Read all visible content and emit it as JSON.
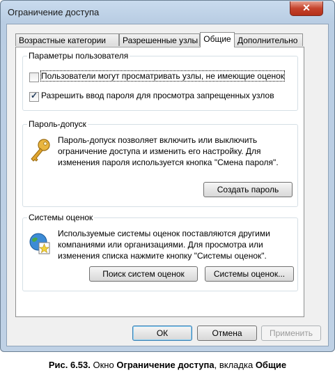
{
  "window": {
    "title": "Ограничение доступа",
    "close_glyph": "✕"
  },
  "tabs": [
    {
      "label": "Возрастные категории",
      "active": false
    },
    {
      "label": "Разрешенные узлы",
      "active": false
    },
    {
      "label": "Общие",
      "active": true
    },
    {
      "label": "Дополнительно",
      "active": false
    }
  ],
  "user_settings": {
    "title": "Параметры пользователя",
    "option1": {
      "label": "Пользователи могут просматривать узлы, не имеющие оценок",
      "checked": false
    },
    "option2": {
      "label": "Разрешить ввод пароля для просмотра запрещенных узлов",
      "checked": true
    }
  },
  "password": {
    "title": "Пароль-допуск",
    "line1": "Пароль-допуск позволяет включить или выключить",
    "line2": "ограничение доступа и изменить его настройку. Для",
    "line3": "изменения пароля используется кнопка \"Смена пароля\".",
    "create_button": "Создать пароль",
    "icon": "key-icon"
  },
  "rating_systems": {
    "title": "Системы оценок",
    "line1": "Используемые системы оценок поставляются другими",
    "line2": "компаниями или организациями. Для просмотра или",
    "line3": "изменения списка нажмите кнопку \"Системы оценок\".",
    "find_button": "Поиск систем оценок",
    "systems_button": "Системы оценок...",
    "icon": "globe-certificate-icon"
  },
  "footer": {
    "ok": "ОК",
    "cancel": "Отмена",
    "apply": "Применить"
  },
  "caption": {
    "prefix": "Рис. 6.53.",
    "text1": "Окно",
    "window_name": "Ограничение доступа",
    "text2": ", вкладка",
    "tab_name": "Общие"
  }
}
